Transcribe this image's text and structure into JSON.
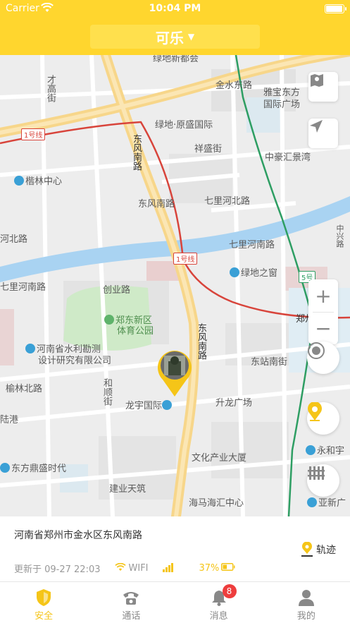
{
  "status_bar": {
    "carrier": "Carrier",
    "time": "10:04 PM",
    "battery_level": 1.0
  },
  "header": {
    "title": "可乐",
    "dropdown_icon": "caret-down-icon"
  },
  "map": {
    "labels": {
      "dichan": "绿地新都会",
      "jinshui_donglu": "金水东路",
      "yabao": "雅宝东方",
      "yabao2": "国际广场",
      "lvdi_yuansheng": "绿地·原盛国际",
      "xiangsheng": "祥盛街",
      "zhonghao": "中豪汇景湾",
      "kaolin": "楷林中心",
      "dongfeng_nanlu_top": "东风南路",
      "dongfeng_nanlu_mid": "东风南路",
      "qili_hebei": "七里河北路",
      "qili_henan": "七里河南路",
      "hebeilu_left": "河北路",
      "qili_nanlu_left": "七里河南路",
      "lvdi_zhichuang": "绿地之窗",
      "chuangye": "创业路",
      "zhengdong_park1": "郑东新区",
      "zhengdong_park2": "体育公园",
      "dongfeng_nanlu_right": "东风南路",
      "zhengzhou_dong": "郑州东站",
      "water1": "河南省水利勘测",
      "water2": "设计研究有限公司",
      "dongzhan_nanjie": "东站南街",
      "yulin": "榆林北路",
      "heshun": "和顺街",
      "longyu": "龙宇国际",
      "shenglong": "升龙广场",
      "lugang": "陆港",
      "yonghe": "永和宇",
      "dongfang": "东方鼎盛时代",
      "wenhua": "文化产业大厦",
      "jianye": "建业天筑",
      "haima": "海马海汇中心",
      "yaxin": "亚新广",
      "caigao": "才高街",
      "line1_a": "1号线",
      "line1_b": "1号线",
      "zhongxing": "中兴路",
      "line5": "5号"
    },
    "buttons": {
      "map_layers": "map-icon",
      "locate": "navigation-arrow-icon",
      "zoom_in": "+",
      "zoom_out": "−",
      "center": "target-icon",
      "pin": "location-pin-icon",
      "fence": "fence-icon"
    }
  },
  "info": {
    "address": "河南省郑州市金水区东风南路",
    "track_label": "轨迹",
    "updated": "更新于 09-27 22:03",
    "network": "WIFI",
    "battery": "37%",
    "battery_level": 0.37
  },
  "tabs": [
    {
      "label": "安全",
      "icon": "shield-icon",
      "active": true
    },
    {
      "label": "通话",
      "icon": "phone-icon",
      "active": false
    },
    {
      "label": "消息",
      "icon": "bell-icon",
      "active": false,
      "badge": "8"
    },
    {
      "label": "我的",
      "icon": "user-icon",
      "active": false
    }
  ],
  "colors": {
    "accent": "#FFD62E",
    "active_tab": "#F5C518",
    "badge": "#EE3D3D",
    "metro_line1": "#D8443B",
    "metro_green": "#2E9E63",
    "river": "#A9D3F2"
  }
}
